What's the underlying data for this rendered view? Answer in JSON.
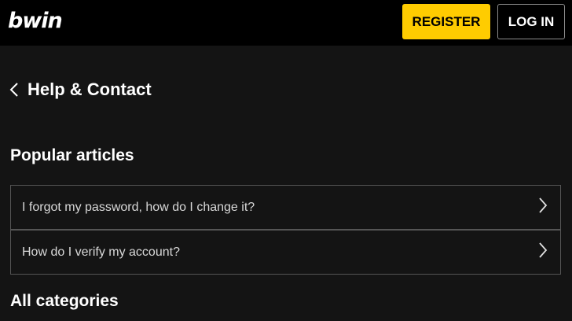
{
  "header": {
    "logo_text": "bwin",
    "register_label": "REGISTER",
    "login_label": "LOG IN",
    "accent_color": "#ffcc00"
  },
  "page": {
    "back_icon": "chevron-left-icon",
    "title": "Help & Contact"
  },
  "popular": {
    "title": "Popular articles",
    "items": [
      {
        "label": "I forgot my password, how do I change it?",
        "icon": "chevron-right-icon"
      },
      {
        "label": "How do I verify my account?",
        "icon": "chevron-right-icon"
      }
    ]
  },
  "categories": {
    "title": "All categories"
  }
}
